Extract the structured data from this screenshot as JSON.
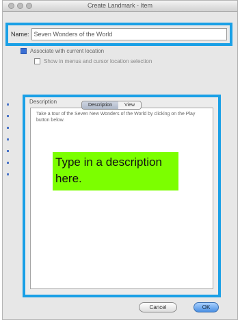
{
  "window": {
    "title": "Create Landmark - Item"
  },
  "name_field": {
    "label": "Name:",
    "value": "Seven Wonders of the World"
  },
  "options": {
    "option_1": "Associate with current location",
    "option_2": "Show in menus and cursor location selection"
  },
  "tabs": [
    {
      "label": "Description",
      "active": true
    },
    {
      "label": "View",
      "active": false
    }
  ],
  "description": {
    "caption": "Description",
    "text": "Take a tour of the Seven New Wonders of the World by clicking on the Play button below."
  },
  "callout": {
    "text": "Type in a description here."
  },
  "buttons": {
    "cancel": "Cancel",
    "ok": "OK"
  },
  "colors": {
    "highlight_border": "#1aa0e6",
    "callout_bg": "#7cff00"
  }
}
